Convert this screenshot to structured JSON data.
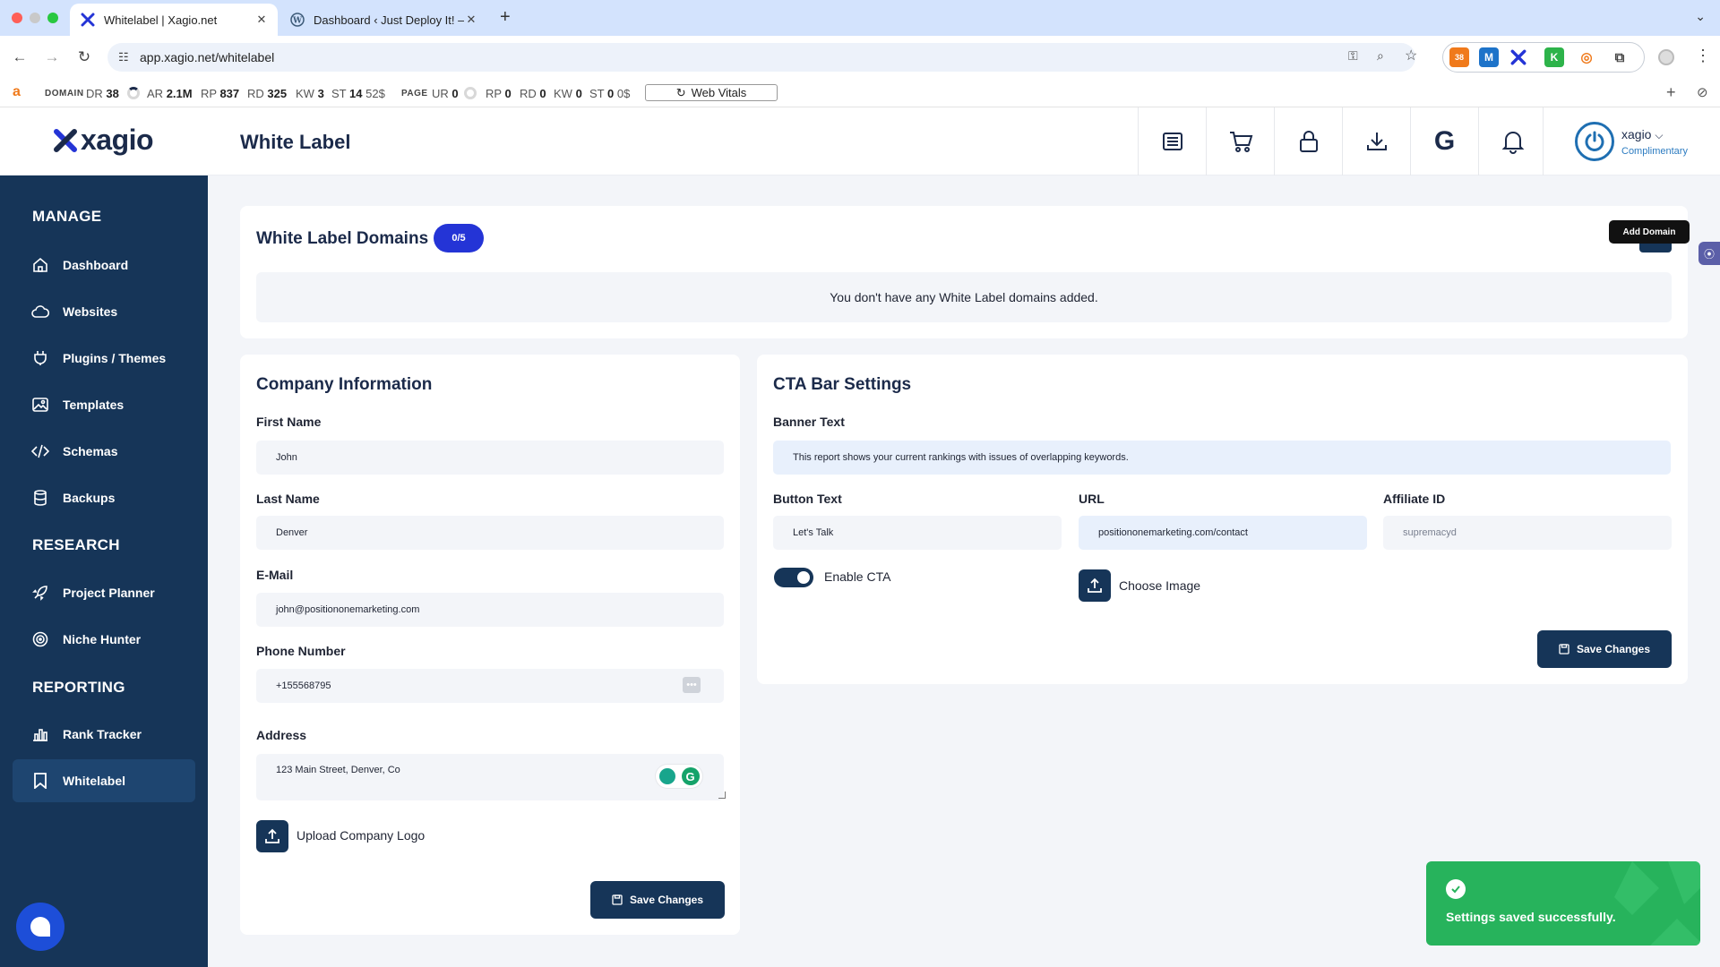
{
  "browser": {
    "tabs": [
      {
        "title": "Whitelabel | Xagio.net",
        "active": true
      },
      {
        "title": "Dashboard ‹ Just Deploy It! —",
        "active": false
      }
    ],
    "url": "app.xagio.net/whitelabel",
    "ext_badge": "38"
  },
  "seo_bar": {
    "domain_label": "DOMAIN",
    "page_label": "PAGE",
    "domain_metrics": [
      {
        "k": "DR",
        "v": "38"
      },
      {
        "k": "AR",
        "v": "2.1M"
      },
      {
        "k": "RP",
        "v": "837"
      },
      {
        "k": "RD",
        "v": "325"
      },
      {
        "k": "KW",
        "v": "3"
      },
      {
        "k": "ST",
        "v": "14",
        "extra": "52$"
      }
    ],
    "page_metrics": [
      {
        "k": "UR",
        "v": "0"
      },
      {
        "k": "RP",
        "v": "0"
      },
      {
        "k": "RD",
        "v": "0"
      },
      {
        "k": "KW",
        "v": "0"
      },
      {
        "k": "ST",
        "v": "0",
        "extra": "0$"
      }
    ],
    "web_vitals": "Web Vitals"
  },
  "header": {
    "logo_text": "xagio",
    "page_title": "White Label",
    "icons": [
      "news-icon",
      "cart-icon",
      "lock-icon",
      "download-icon",
      "google-icon",
      "bell-icon"
    ],
    "user": {
      "name": "xagio",
      "plan": "Complimentary"
    }
  },
  "sidebar": {
    "sections": [
      {
        "title": "MANAGE",
        "items": [
          "Dashboard",
          "Websites",
          "Plugins / Themes",
          "Templates",
          "Schemas",
          "Backups"
        ]
      },
      {
        "title": "RESEARCH",
        "items": [
          "Project Planner",
          "Niche Hunter"
        ]
      },
      {
        "title": "REPORTING",
        "items": [
          "Rank Tracker",
          "Whitelabel"
        ]
      }
    ],
    "active": "Whitelabel"
  },
  "domains": {
    "title": "White Label Domains",
    "count": "0/5",
    "empty": "You don't have any White Label domains added.",
    "add_tooltip": "Add Domain"
  },
  "company": {
    "title": "Company Information",
    "first_name_label": "First Name",
    "first_name": "John",
    "last_name_label": "Last Name",
    "last_name": "Denver",
    "email_label": "E-Mail",
    "email": "john@positiononemarketing.com",
    "phone_label": "Phone Number",
    "phone": "+155568795",
    "address_label": "Address",
    "address": "123 Main Street, Denver, Co",
    "upload_logo": "Upload Company Logo",
    "save": "Save Changes"
  },
  "cta": {
    "title": "CTA Bar Settings",
    "banner_label": "Banner Text",
    "banner": "This report shows your current rankings with issues of overlapping keywords.",
    "button_text_label": "Button Text",
    "button_text": "Let's Talk",
    "url_label": "URL",
    "url": "positiononemarketing.com/contact",
    "affiliate_label": "Affiliate ID",
    "affiliate_placeholder": "supremacyd",
    "enable_label": "Enable CTA",
    "enabled": true,
    "choose_image": "Choose Image",
    "save": "Save Changes"
  },
  "toast": {
    "message": "Settings saved successfully."
  },
  "colors": {
    "sidebar": "#163558",
    "accent_badge": "#2434d6",
    "toast": "#27b35c",
    "content_bg": "#f3f5f9"
  }
}
